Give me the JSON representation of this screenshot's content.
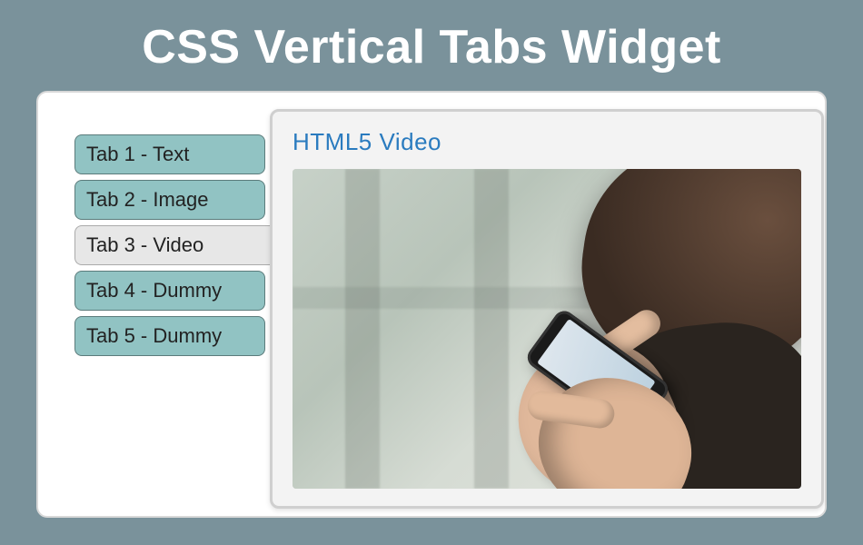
{
  "title": "CSS Vertical Tabs Widget",
  "tabs": [
    {
      "label": "Tab 1 - Text",
      "active": false
    },
    {
      "label": "Tab 2 - Image",
      "active": false
    },
    {
      "label": "Tab 3 - Video",
      "active": true
    },
    {
      "label": "Tab 4 - Dummy",
      "active": false
    },
    {
      "label": "Tab 5 - Dummy",
      "active": false
    }
  ],
  "panel": {
    "title": "HTML5 Video"
  }
}
